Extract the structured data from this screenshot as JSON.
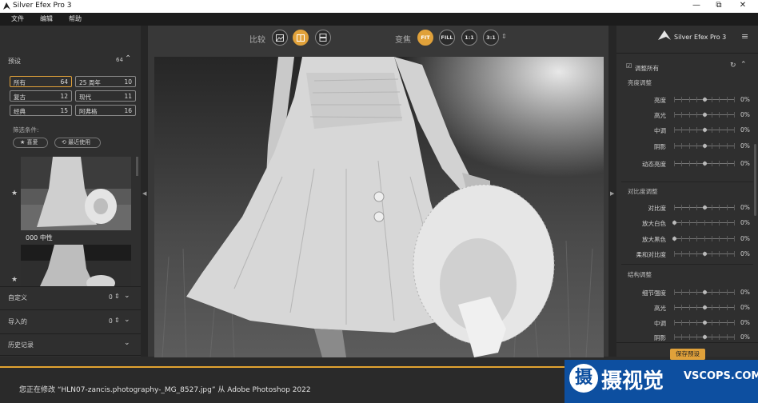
{
  "window": {
    "title": "Silver Efex Pro 3",
    "min": "—",
    "restore": "⧉",
    "close": "✕"
  },
  "menu": [
    "文件",
    "编辑",
    "帮助"
  ],
  "left": {
    "presets_label": "预设",
    "presets_count": "64",
    "categories": [
      {
        "name": "所有",
        "count": "64"
      },
      {
        "name": "25 周年",
        "count": "10"
      },
      {
        "name": "复古",
        "count": "12"
      },
      {
        "name": "现代",
        "count": "11"
      },
      {
        "name": "经典",
        "count": "15"
      },
      {
        "name": "阿弗格",
        "count": "16"
      }
    ],
    "filter_label": "筛选条件:",
    "filter_fav": "★ 喜爱",
    "filter_recent": "⟲ 最近使用",
    "thumb_label": "000 中性",
    "custom": {
      "label": "自定义",
      "count": "0"
    },
    "imported": {
      "label": "导入的",
      "count": "0"
    },
    "history": {
      "label": "历史记录"
    }
  },
  "toolbar": {
    "compare_label": "比较",
    "zoom_label": "变焦",
    "zoom_options": [
      "FIT",
      "FILL",
      "1:1",
      "3:1"
    ]
  },
  "right": {
    "brand": "Silver Efex Pro 3",
    "adjust_all": "调整所有",
    "sections": [
      {
        "title": "亮度调整",
        "sliders": [
          {
            "label": "亮度",
            "value": "0%"
          },
          {
            "label": "高光",
            "value": "0%"
          },
          {
            "label": "中调",
            "value": "0%"
          },
          {
            "label": "阴影",
            "value": "0%"
          },
          {
            "label": "动态亮度",
            "value": "0%"
          }
        ]
      },
      {
        "title": "对比度调整",
        "sliders": [
          {
            "label": "对比度",
            "value": "0%"
          },
          {
            "label": "放大白色",
            "value": "0%"
          },
          {
            "label": "放大黑色",
            "value": "0%"
          },
          {
            "label": "柔和对比度",
            "value": "0%"
          }
        ]
      },
      {
        "title": "结构调整",
        "sliders": [
          {
            "label": "细节强度",
            "value": "0%"
          },
          {
            "label": "高光",
            "value": "0%"
          },
          {
            "label": "中调",
            "value": "0%"
          },
          {
            "label": "阴影",
            "value": "0%"
          }
        ]
      }
    ],
    "save_preset": "保存预设"
  },
  "status": {
    "text": "您正在修改 “HLN07-zancis.photography-_MG_8527.jpg” 从 Adobe Photoshop 2022"
  },
  "watermark": {
    "logo": "摄",
    "cn": "摄视觉",
    "en": "VSCOPS.COM"
  },
  "colors": {
    "accent": "#e0a13a",
    "watermark_bg": "#0d4fa0"
  }
}
